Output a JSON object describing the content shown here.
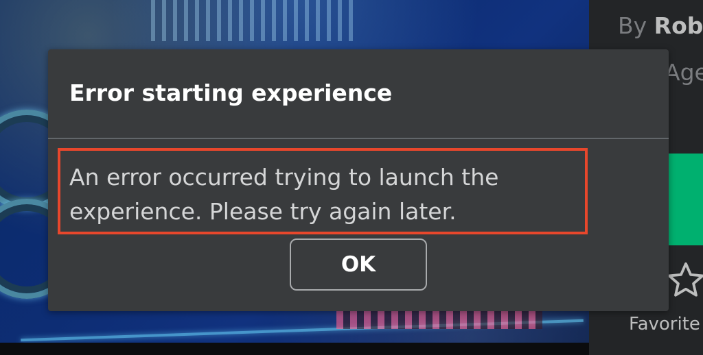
{
  "dialog": {
    "title": "Error starting experience",
    "message": "An error occurred trying to launch the experience. Please try again later.",
    "ok_label": "OK",
    "highlight_color": "#e8472c"
  },
  "side_panel": {
    "creator_prefix": "By",
    "creator_name": "Rob",
    "age_label": "Age",
    "favorite_label": "Favorite",
    "favorite_icon": "star-icon",
    "play_color": "#00b06f"
  }
}
